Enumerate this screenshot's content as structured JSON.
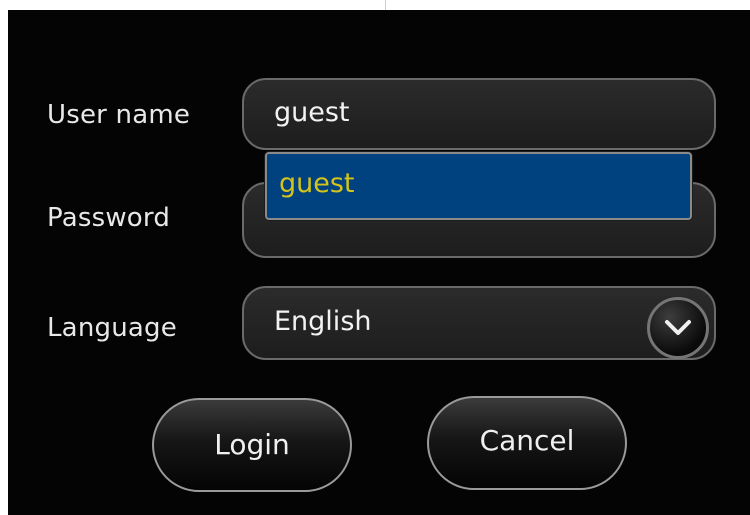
{
  "form": {
    "username_label": "User name",
    "username_value": "guest",
    "password_label": "Password",
    "password_value": "",
    "language_label": "Language",
    "language_value": "English"
  },
  "autocomplete": {
    "items": [
      "guest"
    ]
  },
  "buttons": {
    "login": "Login",
    "cancel": "Cancel"
  },
  "icons": {
    "language_dropdown": "chevron-down-icon"
  },
  "colors": {
    "background": "#040404",
    "autocomplete_highlight": "#00427f",
    "autocomplete_text": "#d4c31a"
  }
}
